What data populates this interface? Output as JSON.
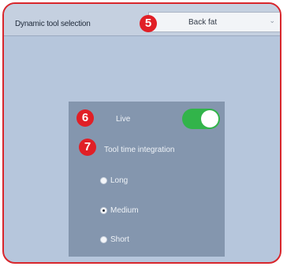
{
  "header": {
    "tool_label": "Dynamic tool selection",
    "dropdown_value": "Back fat"
  },
  "settings": {
    "live_label": "Live",
    "live_enabled": true,
    "integration_label": "Tool time integration",
    "options": [
      "Long",
      "Medium",
      "Short"
    ],
    "selected_option": "Medium"
  },
  "callouts": [
    "5",
    "6",
    "7"
  ],
  "colors": {
    "frame_border": "#d8262c",
    "callout": "#e11f26",
    "toggle_on": "#32b44a",
    "panel": "#8496ae",
    "background": "#b6c6dc"
  }
}
